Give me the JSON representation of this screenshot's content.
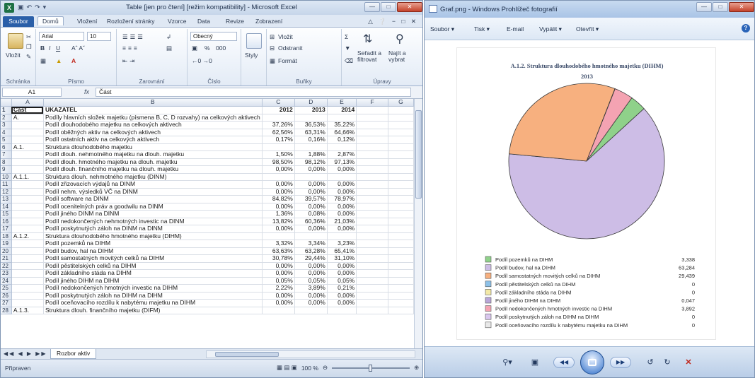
{
  "excel": {
    "title": "Table [jen pro čtení] [režim kompatibility] - Microsoft Excel",
    "file_tab": "Soubor",
    "tabs": [
      "Domů",
      "Vložení",
      "Rozložení stránky",
      "Vzorce",
      "Data",
      "Revize",
      "Zobrazení"
    ],
    "ribbon": {
      "paste": "Vložit",
      "font_name": "Arial",
      "font_size": "10",
      "number_format": "Obecný",
      "percent": "%",
      "thousands": "000",
      "styles": "Styly",
      "insert": "Vložit",
      "delete": "Odstranit",
      "format": "Formát",
      "sort": "Seřadit a filtrovat",
      "find": "Najít a vybrat",
      "groups": [
        "Schránka",
        "Písmo",
        "Zarovnání",
        "Číslo",
        "Buňky",
        "Úpravy"
      ]
    },
    "name_box": "A1",
    "fx": "fx",
    "formula": "Část",
    "columns": [
      "A",
      "B",
      "C",
      "D",
      "E",
      "F",
      "G"
    ],
    "rows": [
      {
        "n": "1",
        "a": "Část",
        "b": "UKAZATEL",
        "c": "2012",
        "d": "2013",
        "e": "2014"
      },
      {
        "n": "2",
        "a": "A.",
        "b": "Podíly hlavních složek majetku (písmena B, C, D rozvahy) na celkových aktivech",
        "c": "",
        "d": "",
        "e": ""
      },
      {
        "n": "3",
        "a": "",
        "b": "Podíl dlouhodobého majetku na celkových aktivech",
        "c": "37,26%",
        "d": "36,53%",
        "e": "35,22%"
      },
      {
        "n": "4",
        "a": "",
        "b": "Podíl oběžných aktiv na celkových aktivech",
        "c": "62,56%",
        "d": "63,31%",
        "e": "64,66%"
      },
      {
        "n": "5",
        "a": "",
        "b": "Podíl ostatních aktiv na celkových aktivech",
        "c": "0,17%",
        "d": "0,16%",
        "e": "0,12%"
      },
      {
        "n": "6",
        "a": "A.1.",
        "b": "Struktura dlouhodobého majetku",
        "c": "",
        "d": "",
        "e": ""
      },
      {
        "n": "7",
        "a": "",
        "b": "Podíl dlouh. nehmotného majetku na dlouh. majetku",
        "c": "1,50%",
        "d": "1,88%",
        "e": "2,87%"
      },
      {
        "n": "8",
        "a": "",
        "b": "Podíl dlouh. hmotného majetku na dlouh. majetku",
        "c": "98,50%",
        "d": "98,12%",
        "e": "97,13%"
      },
      {
        "n": "9",
        "a": "",
        "b": "Podíl dlouh. finančního majetku na dlouh. majetku",
        "c": "0,00%",
        "d": "0,00%",
        "e": "0,00%"
      },
      {
        "n": "10",
        "a": "A.1.1.",
        "b": "Struktura dlouh. nehmotného majetku (DINM)",
        "c": "",
        "d": "",
        "e": ""
      },
      {
        "n": "11",
        "a": "",
        "b": "Podíl zřizovacích výdajů na DINM",
        "c": "0,00%",
        "d": "0,00%",
        "e": "0,00%"
      },
      {
        "n": "12",
        "a": "",
        "b": "Podíl nehm. výsledků VČ na DINM",
        "c": "0,00%",
        "d": "0,00%",
        "e": "0,00%"
      },
      {
        "n": "13",
        "a": "",
        "b": "Podíl software na DINM",
        "c": "84,82%",
        "d": "39,57%",
        "e": "78,97%"
      },
      {
        "n": "14",
        "a": "",
        "b": "Podíl ocenitelných práv a goodwilu na DINM",
        "c": "0,00%",
        "d": "0,00%",
        "e": "0,00%"
      },
      {
        "n": "15",
        "a": "",
        "b": "Podíl jiného DINM na DINM",
        "c": "1,36%",
        "d": "0,08%",
        "e": "0,00%"
      },
      {
        "n": "16",
        "a": "",
        "b": "Podíl nedokončených nehmotných investic na DINM",
        "c": "13,82%",
        "d": "60,36%",
        "e": "21,03%"
      },
      {
        "n": "17",
        "a": "",
        "b": "Podíl poskytnutých záloh na DINM na DINM",
        "c": "0,00%",
        "d": "0,00%",
        "e": "0,00%"
      },
      {
        "n": "18",
        "a": "A.1.2.",
        "b": "Struktura dlouhodobého hmotného majetku (DIHM)",
        "c": "",
        "d": "",
        "e": ""
      },
      {
        "n": "19",
        "a": "",
        "b": "Podíl pozemků na DIHM",
        "c": "3,32%",
        "d": "3,34%",
        "e": "3,23%"
      },
      {
        "n": "20",
        "a": "",
        "b": "Podíl budov, hal na DIHM",
        "c": "63,63%",
        "d": "63,28%",
        "e": "65,41%"
      },
      {
        "n": "21",
        "a": "",
        "b": "Podíl samostatných movitých celků na DIHM",
        "c": "30,78%",
        "d": "29,44%",
        "e": "31,10%"
      },
      {
        "n": "22",
        "a": "",
        "b": "Podíl pěstitelských celků na DIHM",
        "c": "0,00%",
        "d": "0,00%",
        "e": "0,00%"
      },
      {
        "n": "23",
        "a": "",
        "b": "Podíl základního stáda na DIHM",
        "c": "0,00%",
        "d": "0,00%",
        "e": "0,00%"
      },
      {
        "n": "24",
        "a": "",
        "b": "Podíl jiného DIHM na DIHM",
        "c": "0,05%",
        "d": "0,05%",
        "e": "0,05%"
      },
      {
        "n": "25",
        "a": "",
        "b": "Podíl nedokončených hmotných investic na DIHM",
        "c": "2,22%",
        "d": "3,89%",
        "e": "0,21%"
      },
      {
        "n": "26",
        "a": "",
        "b": "Podíl poskytnutých záloh na DIHM na DIHM",
        "c": "0,00%",
        "d": "0,00%",
        "e": "0,00%"
      },
      {
        "n": "27",
        "a": "",
        "b": "Podíl oceňovacího rozdílu k nabytému majetku na DIHM",
        "c": "0,00%",
        "d": "0,00%",
        "e": "0,00%"
      },
      {
        "n": "28",
        "a": "A.1.3.",
        "b": "Struktura dlouh. finančního majetku (DIFM)",
        "c": "",
        "d": "",
        "e": ""
      }
    ],
    "sheet_tab": "Rozbor aktiv",
    "status": "Připraven",
    "zoom": "100 %"
  },
  "viewer": {
    "title": "Graf.png - Windows Prohlížeč fotografií",
    "menu": [
      "Soubor",
      "Tisk",
      "E-mail",
      "Vypálit",
      "Otevřít"
    ],
    "help": "?"
  },
  "chart_data": {
    "type": "pie",
    "title": "A.1.2. Struktura dlouhodobého hmotného majetku (DIHM)",
    "subtitle": "2013",
    "legend_position": "bottom",
    "slices": [
      {
        "label": "Podíl pozemků na DIHM",
        "value": 3.338,
        "value_label": "3,338",
        "color": "#8fd18a"
      },
      {
        "label": "Podíl budov, hal na DIHM",
        "value": 63.284,
        "value_label": "63,284",
        "color": "#cdbde6"
      },
      {
        "label": "Podíl samostatných movitých celků na DIHM",
        "value": 29.439,
        "value_label": "29,439",
        "color": "#f7b07f"
      },
      {
        "label": "Podíl pěstitelských celků na DIHM",
        "value": 0,
        "value_label": "0",
        "color": "#8dc1e8"
      },
      {
        "label": "Podíl základního stáda na DIHM",
        "value": 0,
        "value_label": "0",
        "color": "#f3e9a6"
      },
      {
        "label": "Podíl jiného DIHM na DIHM",
        "value": 0.047,
        "value_label": "0,047",
        "color": "#b9a6d8"
      },
      {
        "label": "Podíl nedokončených hmotných investic na DIHM",
        "value": 3.892,
        "value_label": "3,892",
        "color": "#f4a3b2"
      },
      {
        "label": "Podíl poskytnutých záloh na DIHM na DIHM",
        "value": 0,
        "value_label": "0",
        "color": "#d9c7ee"
      },
      {
        "label": "Podíl oceňovacího rozdílu k nabytému majetku na DIHM",
        "value": 0,
        "value_label": "0",
        "color": "#e8e8e8"
      }
    ]
  }
}
